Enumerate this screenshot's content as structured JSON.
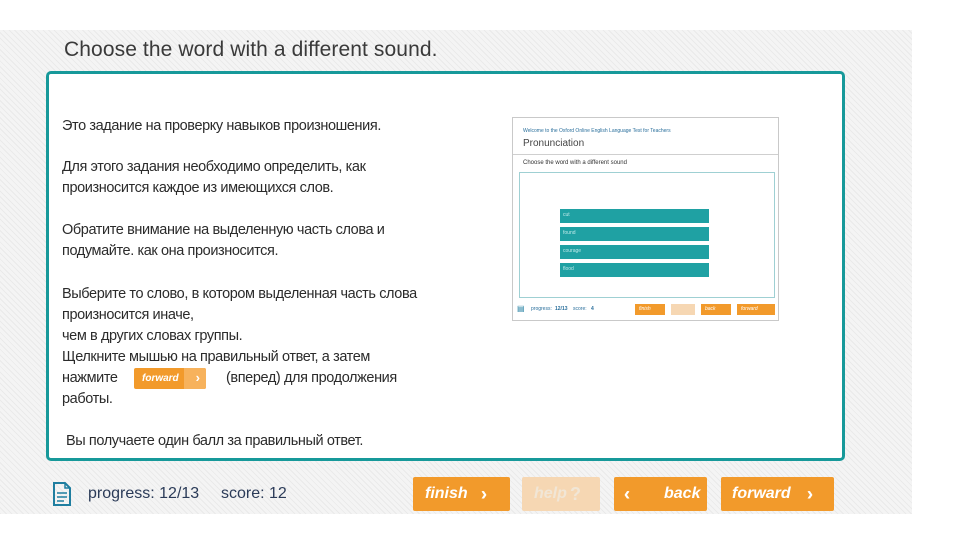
{
  "title": "Choose the word with a different sound.",
  "instructions": {
    "p1": "Это задание на  проверку навыков  произношения.",
    "p2a": "Для этого задания необходимо определить, как",
    "p2b": "произносится каждое из имеющихся слов.",
    "p3a": "Обратите внимание на выделенную  часть слова и",
    "p3b": "подумайте.  как она произносится.",
    "p4a": "Выберите то слово, в котором выделенная часть слова",
    "p4b": "произносится  иначе,",
    "p4c": "чем в других словах группы.",
    "p4d": "Щелкните мышью на правильный ответ, а затем",
    "p4e_pre": "нажмите",
    "p4e_post": "(вперед)  для продолжения",
    "p4f": "работы.",
    "p5": "Вы получаете один балл за правильный ответ.",
    "inline_button": "forward"
  },
  "preview": {
    "welcome": "Welcome to the Oxford Online English Language Test for Teachers",
    "heading": "Pronunciation",
    "question": "Choose the word with a different sound",
    "options": [
      "cut",
      "found",
      "courage",
      "flood"
    ],
    "progress_label": "progress:",
    "progress_value": "12/13",
    "score_label": "score:",
    "score_value": "4",
    "finish": "finish",
    "back": "back",
    "forward": "forward"
  },
  "footer": {
    "progress_label": "progress:",
    "progress_value": "12/13",
    "score_label": "score:",
    "score_value": "12",
    "finish_label": "finish",
    "help_label": "help",
    "back_label": "back",
    "forward_label": "forward"
  },
  "colors": {
    "accent": "#17999a",
    "button": "#f29a2b",
    "text": "#2b3b58"
  }
}
